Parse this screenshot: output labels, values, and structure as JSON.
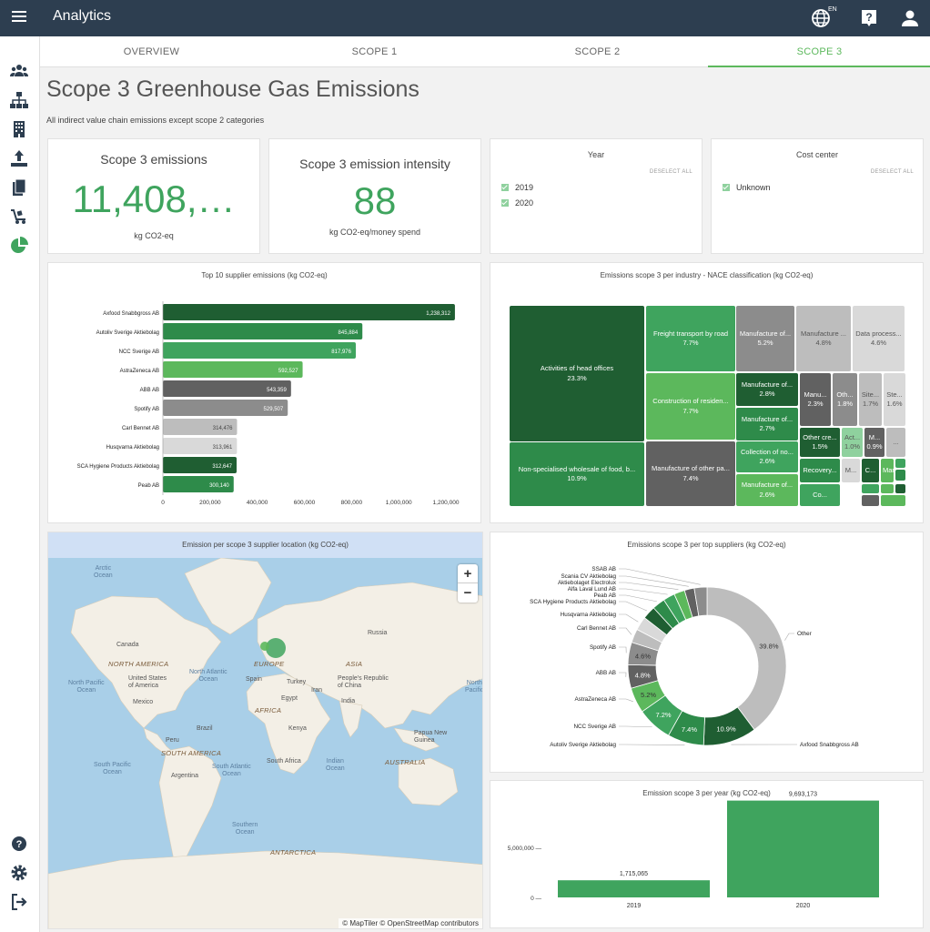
{
  "header": {
    "app_title": "Analytics",
    "lang_sup": "EN"
  },
  "tabs": [
    {
      "label": "OVERVIEW"
    },
    {
      "label": "SCOPE 1"
    },
    {
      "label": "SCOPE 2"
    },
    {
      "label": "SCOPE 3"
    }
  ],
  "page": {
    "title": "Scope 3 Greenhouse Gas Emissions",
    "subtitle": "All indirect value chain emissions except scope 2 categories"
  },
  "kpis": [
    {
      "title": "Scope 3 emissions",
      "value": "11,408,…",
      "unit": "kg CO2-eq"
    },
    {
      "title": "Scope 3 emission intensity",
      "value": "88",
      "unit": "kg CO2-eq/money spend"
    }
  ],
  "filters": {
    "year": {
      "title": "Year",
      "deselect": "DESELECT ALL",
      "items": [
        "2019",
        "2020"
      ]
    },
    "cost": {
      "title": "Cost center",
      "deselect": "DESELECT ALL",
      "items": [
        "Unknown"
      ]
    }
  },
  "colors": {
    "dark": "#1f5e32",
    "green1": "#2e8b4a",
    "green2": "#3fa45e",
    "green3": "#5cb85c",
    "light": "#8fd19e",
    "grey1": "#616161",
    "grey2": "#8c8c8c",
    "grey3": "#bdbdbd",
    "grey4": "#d9d9d9"
  },
  "chart_data": [
    {
      "type": "bar",
      "orientation": "horizontal",
      "title": "Top 10 supplier emissions (kg CO2-eq)",
      "categories": [
        "Axfood Snabbgross AB",
        "Autoliv Sverige Aktiebolag",
        "NCC Sverige AB",
        "AstraZeneca AB",
        "ABB AB",
        "Spotify AB",
        "Carl Bennet AB",
        "Husqvarna Aktiebolag",
        "SCA Hygiene Products Aktiebolag",
        "Peab AB"
      ],
      "values": [
        1238312,
        845884,
        817976,
        592527,
        543359,
        529507,
        314476,
        313961,
        312647,
        300140
      ],
      "labels": [
        "1,238,312",
        "845,884",
        "817,976",
        "592,527",
        "543,359",
        "529,507",
        "314,476",
        "313,961",
        "312,647",
        "300,140"
      ],
      "colors": [
        "#1f5e32",
        "#2e8b4a",
        "#3fa45e",
        "#5cb85c",
        "#616161",
        "#8c8c8c",
        "#bdbdbd",
        "#d9d9d9",
        "#1f5e32",
        "#2e8b4a"
      ],
      "xticks": [
        "0",
        "200,000",
        "400,000",
        "600,000",
        "800,000",
        "1,000,000",
        "1,200,000"
      ],
      "xlim": [
        0,
        1300000
      ]
    },
    {
      "type": "treemap",
      "title": "Emissions scope 3 per industry - NACE classification (kg CO2-eq)",
      "items": [
        {
          "name": "Activities of head offices",
          "pct": "23.3%"
        },
        {
          "name": "Non-specialised wholesale of food, b...",
          "pct": "10.9%"
        },
        {
          "name": "Freight transport by road",
          "pct": "7.7%"
        },
        {
          "name": "Construction of residen...",
          "pct": "7.7%"
        },
        {
          "name": "Manufacture of other pa...",
          "pct": "7.4%"
        },
        {
          "name": "Manufacture of...",
          "pct": "5.2%"
        },
        {
          "name": "Manufacture ...",
          "pct": "4.8%"
        },
        {
          "name": "Data process...",
          "pct": "4.6%"
        },
        {
          "name": "Manufacture of...",
          "pct": "2.8%"
        },
        {
          "name": "Manufacture of...",
          "pct": "2.7%"
        },
        {
          "name": "Collection of no...",
          "pct": "2.6%"
        },
        {
          "name": "Manufacture of...",
          "pct": "2.6%"
        },
        {
          "name": "Manu...",
          "pct": "2.3%"
        },
        {
          "name": "Oth...",
          "pct": "1.8%"
        },
        {
          "name": "Site...",
          "pct": "1.7%"
        },
        {
          "name": "Ste...",
          "pct": "1.6%"
        },
        {
          "name": "Other cre...",
          "pct": "1.5%"
        },
        {
          "name": "Act...",
          "pct": "1.0%"
        },
        {
          "name": "M...",
          "pct": "0.9%"
        },
        {
          "name": "...",
          "pct": ""
        },
        {
          "name": "Recovery...",
          "pct": ""
        },
        {
          "name": "M...",
          "pct": ""
        },
        {
          "name": "C...",
          "pct": ""
        },
        {
          "name": "Manufac...",
          "pct": ""
        },
        {
          "name": "Co...",
          "pct": ""
        }
      ]
    },
    {
      "type": "pie",
      "title": "Emissions scope 3 per top suppliers (kg CO2-eq)",
      "slices": [
        {
          "name": "Other",
          "pct": 39.8,
          "label": "39.8%",
          "color": "#bdbdbd"
        },
        {
          "name": "Axfood Snabbgross AB",
          "pct": 10.9,
          "label": "10.9%",
          "color": "#1f5e32"
        },
        {
          "name": "Autoliv Sverige Aktiebolag",
          "pct": 7.4,
          "label": "7.4%",
          "color": "#2e8b4a"
        },
        {
          "name": "NCC Sverige AB",
          "pct": 7.2,
          "label": "7.2%",
          "color": "#3fa45e"
        },
        {
          "name": "AstraZeneca AB",
          "pct": 5.2,
          "label": "5.2%",
          "color": "#5cb85c"
        },
        {
          "name": "ABB AB",
          "pct": 4.8,
          "label": "4.8%",
          "color": "#616161"
        },
        {
          "name": "Spotify AB",
          "pct": 4.6,
          "label": "4.6%",
          "color": "#8c8c8c"
        },
        {
          "name": "Carl Bennet AB",
          "pct": 2.8,
          "label": "",
          "color": "#bdbdbd"
        },
        {
          "name": "Husqvarna Aktiebolag",
          "pct": 2.8,
          "label": "",
          "color": "#d9d9d9"
        },
        {
          "name": "SCA Hygiene Products Aktiebolag",
          "pct": 2.7,
          "label": "",
          "color": "#1f5e32"
        },
        {
          "name": "Peab AB",
          "pct": 2.6,
          "label": "",
          "color": "#2e8b4a"
        },
        {
          "name": "Alfa Laval Lund AB",
          "pct": 2.4,
          "label": "",
          "color": "#3fa45e"
        },
        {
          "name": "Aktiebolaget Electrolux",
          "pct": 2.2,
          "label": "",
          "color": "#5cb85c"
        },
        {
          "name": "Scania CV Aktiebolag",
          "pct": 2.0,
          "label": "",
          "color": "#616161"
        },
        {
          "name": "SSAB AB",
          "pct": 2.6,
          "label": "",
          "color": "#8c8c8c"
        }
      ]
    },
    {
      "type": "bar",
      "title": "Emission scope 3 per year (kg CO2-eq)",
      "categories": [
        "2019",
        "2020"
      ],
      "values": [
        1715065,
        9693173
      ],
      "labels": [
        "1,715,065",
        "9,693,173"
      ],
      "yticks": [
        "5,000,000 —",
        "0 —"
      ],
      "ylim": [
        0,
        10000000
      ]
    }
  ],
  "map": {
    "title": "Emission per scope 3 supplier location (kg CO2-eq)",
    "zoom_in": "+",
    "zoom_out": "−",
    "attribution": "© MapTiler © OpenStreetMap contributors",
    "oceans": [
      "Arctic\nOcean",
      "North Atlantic\nOcean",
      "North Pacific\nOcean",
      "South Pacific\nOcean",
      "South Atlantic\nOcean",
      "Indian\nOcean",
      "Southern\nOcean",
      "North\nPacific"
    ],
    "continents": [
      "NORTH AMERICA",
      "SOUTH AMERICA",
      "EUROPE",
      "AFRICA",
      "ASIA",
      "AUSTRALIA",
      "ANTARCTICA"
    ],
    "countries": [
      "Canada",
      "United States\nof America",
      "Mexico",
      "Brazil",
      "Peru",
      "Argentina",
      "Russia",
      "Spain",
      "Turkey",
      "Egypt",
      "Iran",
      "India",
      "People's Republic\nof China",
      "Kenya",
      "South Africa",
      "Papua New\nGuinea"
    ]
  }
}
